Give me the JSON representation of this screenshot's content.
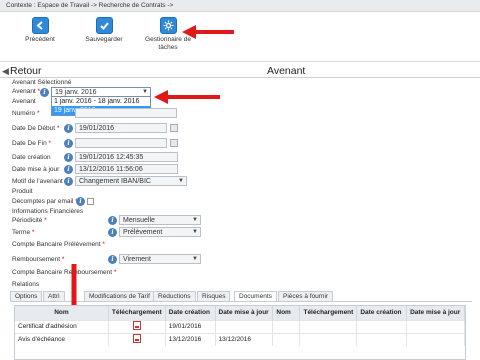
{
  "context": "Contexte : Espace de Travail -> Recherche de Contrats ->",
  "toolbar": {
    "precedent": "Précédent",
    "sauvegarder": "Sauvegarder",
    "gestionnaire_line1": "Gestionnaire de",
    "gestionnaire_line2": "tâches"
  },
  "header": {
    "retour": "Retour",
    "title": "Avenant"
  },
  "form": {
    "section_avenant": "Avenant Sélectionné",
    "avenant_label": "Avenant",
    "avenant_value": "19 janv. 2016",
    "dropdown_options": [
      "1 janv. 2016 - 18 janv. 2016",
      "19 janv. 2016"
    ],
    "avenant2_label": "Avenant",
    "numero_label": "Numéro",
    "date_debut_label": "Date De Début",
    "date_debut_value": "19/01/2016",
    "date_fin_label": "Date De Fin",
    "date_creation_label": "Date création",
    "date_creation_value": "19/01/2016 12:45:35",
    "date_maj_label": "Date mise à jour",
    "date_maj_value": "13/12/2016 11:56:06",
    "motif_label": "Motif de l'avenant",
    "motif_value": "Changement IBAN/BIC",
    "section_produit": "Produit",
    "decomptes_label": "Décomptes par email",
    "section_infos": "Informations Financières",
    "periodicite_label": "Périodicité",
    "periodicite_value": "Mensuelle",
    "terme_label": "Terme",
    "terme_value": "Prélèvement",
    "compte_prelevement_label": "Compte Bancaire Prélèvement",
    "remboursement_label": "Remboursement",
    "remboursement_value": "Virement",
    "compte_remboursement_label": "Compte Bancaire Remboursement",
    "section_relations": "Relations"
  },
  "tabs": [
    "Options",
    "Attri",
    "Modifications de Tarif",
    "Réductions",
    "Risques",
    "Documents",
    "Pièces à fournir"
  ],
  "documents": {
    "headers": [
      "Nom",
      "Téléchargement",
      "Date création",
      "Date mise à jour",
      "Nom",
      "Téléchargement",
      "Date création",
      "Date mise à jour"
    ],
    "rows": [
      [
        "Certificat d'adhésion",
        "",
        "19/01/2016",
        "",
        "",
        "",
        "",
        ""
      ],
      [
        "Avis d'échéance",
        "",
        "13/12/2016",
        "13/12/2016",
        "",
        "",
        "",
        ""
      ]
    ]
  },
  "colors": {
    "accent": "#2f89d8",
    "arrow": "#e01818"
  }
}
